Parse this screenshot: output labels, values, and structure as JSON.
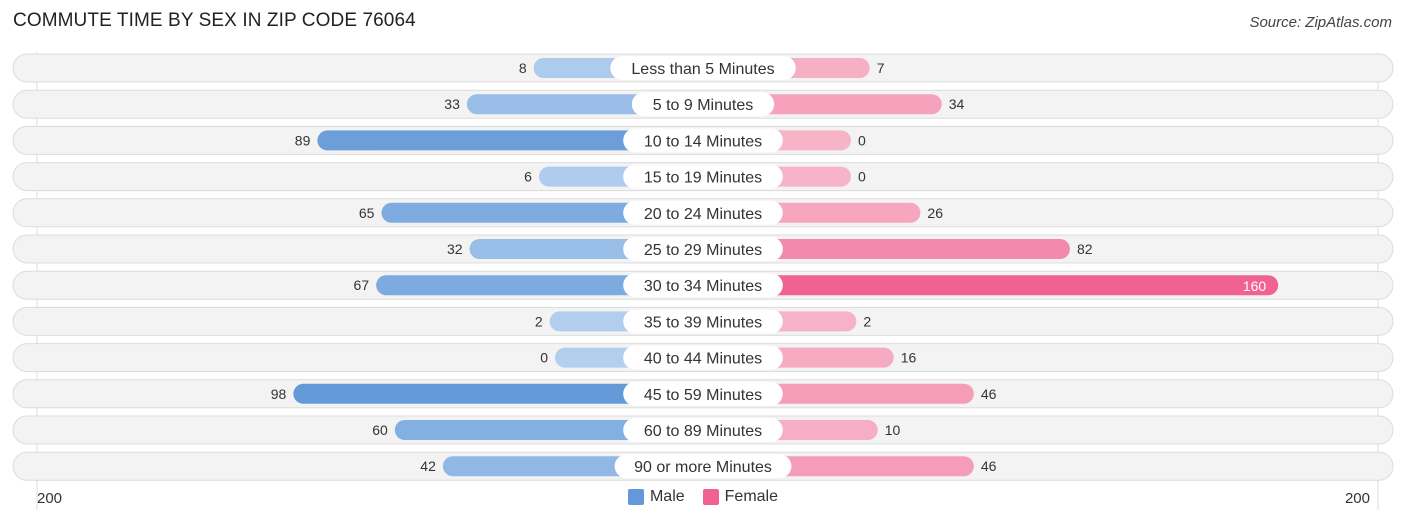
{
  "chart_data": {
    "type": "bar",
    "orientation": "horizontal-diverging",
    "title": "COMMUTE TIME BY SEX IN ZIP CODE 76064",
    "source": "Source: ZipAtlas.com",
    "categories": [
      "Less than 5 Minutes",
      "5 to 9 Minutes",
      "10 to 14 Minutes",
      "15 to 19 Minutes",
      "20 to 24 Minutes",
      "25 to 29 Minutes",
      "30 to 34 Minutes",
      "35 to 39 Minutes",
      "40 to 44 Minutes",
      "45 to 59 Minutes",
      "60 to 89 Minutes",
      "90 or more Minutes"
    ],
    "series": [
      {
        "name": "Male",
        "color": "#6399d8",
        "values": [
          8,
          33,
          89,
          6,
          65,
          32,
          67,
          2,
          0,
          98,
          60,
          42
        ]
      },
      {
        "name": "Female",
        "color": "#f06292",
        "values": [
          7,
          34,
          0,
          0,
          26,
          82,
          160,
          2,
          16,
          46,
          10,
          46
        ]
      }
    ],
    "xlim": [
      -200,
      200
    ],
    "axis_tick_labels": {
      "left": "200",
      "right": "200"
    },
    "legend_position": "bottom-center",
    "grid": false
  }
}
